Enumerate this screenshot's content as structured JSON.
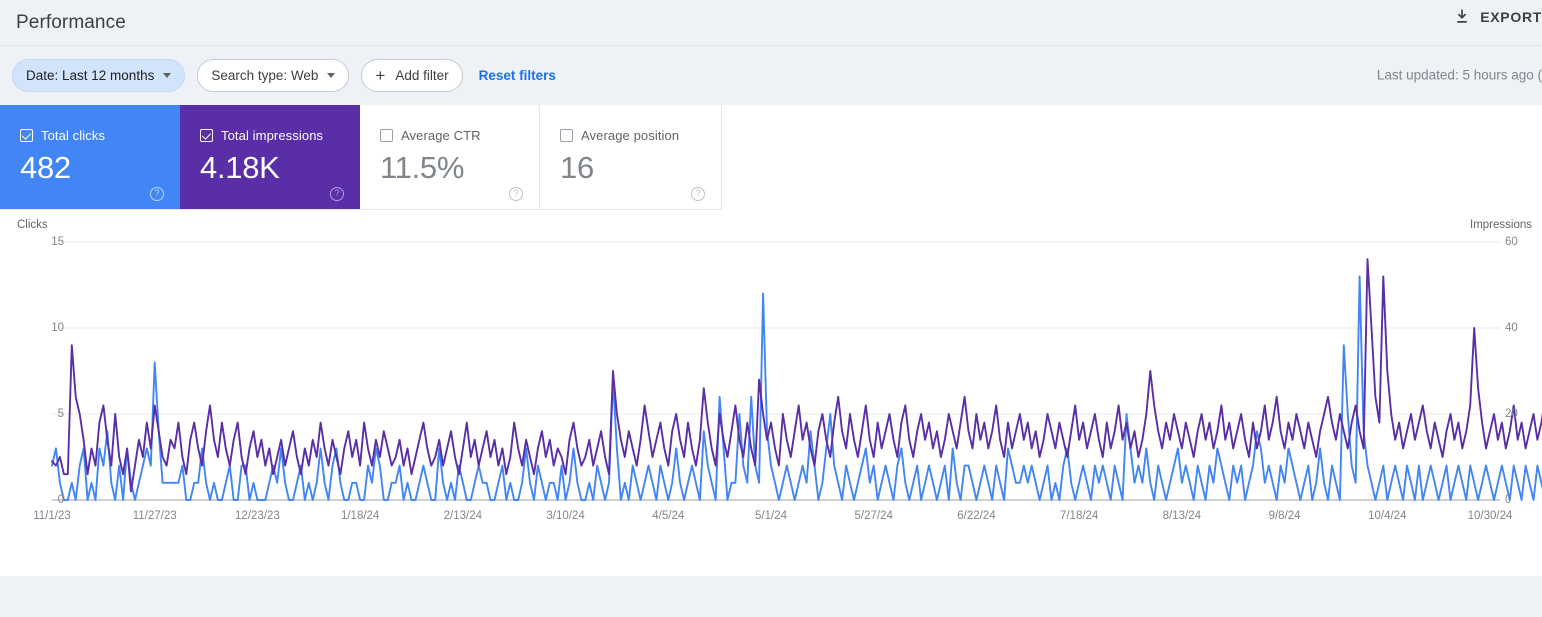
{
  "header": {
    "title": "Performance",
    "export_label": "EXPORT",
    "export_icon": "download-icon"
  },
  "filters": {
    "date_chip": "Date: Last 12 months",
    "search_type_chip": "Search type: Web",
    "add_filter": "Add filter",
    "reset_filters": "Reset filters",
    "last_updated": "Last updated: 5 hours ago ("
  },
  "metrics": [
    {
      "label": "Total clicks",
      "value": "482",
      "checked": true,
      "theme": "blue"
    },
    {
      "label": "Total impressions",
      "value": "4.18K",
      "checked": true,
      "theme": "purple"
    },
    {
      "label": "Average CTR",
      "value": "11.5%",
      "checked": false,
      "theme": "plain"
    },
    {
      "label": "Average position",
      "value": "16",
      "checked": false,
      "theme": "plain"
    }
  ],
  "colors": {
    "clicks": "#4285f4",
    "impressions": "#5a2ea6",
    "accent_link": "#1a73e8",
    "chip_active_bg": "#d2e3fc",
    "page_bg": "#eef1f6"
  },
  "chart_data": {
    "type": "line",
    "title": "",
    "xlabel": "",
    "grid": true,
    "legend": "metric-cards",
    "left_axis": {
      "label": "Clicks",
      "ticks": [
        0,
        5,
        10,
        15
      ],
      "ylim": [
        0,
        15
      ]
    },
    "right_axis": {
      "label": "Impressions",
      "ticks": [
        0,
        20,
        40,
        60
      ],
      "ylim": [
        0,
        60
      ]
    },
    "x_tick_labels": [
      "11/1/23",
      "11/27/23",
      "12/23/23",
      "1/18/24",
      "2/13/24",
      "3/10/24",
      "4/5/24",
      "5/1/24",
      "5/27/24",
      "6/22/24",
      "7/18/24",
      "8/13/24",
      "9/8/24",
      "10/4/24",
      "10/30/24"
    ],
    "x_tick_positions": [
      0,
      26,
      52,
      78,
      104,
      130,
      156,
      182,
      208,
      234,
      260,
      286,
      312,
      338,
      364
    ],
    "n_points": 365,
    "series": [
      {
        "name": "Total clicks",
        "color": "#4285f4",
        "axis": "left",
        "unit": "clicks",
        "values": [
          2,
          3,
          1,
          0,
          0,
          1,
          0,
          2,
          3,
          0,
          1,
          0,
          3,
          2,
          4,
          1,
          0,
          2,
          0,
          3,
          1,
          0,
          1,
          2,
          3,
          2,
          8,
          4,
          1,
          1,
          1,
          1,
          1,
          2,
          0,
          0,
          1,
          1,
          3,
          1,
          0,
          1,
          0,
          0,
          1,
          2,
          0,
          0,
          2,
          2,
          0,
          1,
          0,
          0,
          0,
          1,
          2,
          1,
          3,
          1,
          0,
          0,
          1,
          2,
          0,
          1,
          0,
          1,
          3,
          1,
          0,
          2,
          3,
          1,
          0,
          0,
          1,
          1,
          0,
          0,
          2,
          1,
          3,
          2,
          0,
          0,
          1,
          1,
          2,
          0,
          1,
          0,
          0,
          1,
          2,
          1,
          0,
          0,
          3,
          1,
          0,
          1,
          0,
          2,
          1,
          0,
          0,
          1,
          2,
          1,
          1,
          0,
          0,
          1,
          2,
          0,
          1,
          0,
          0,
          1,
          3,
          1,
          0,
          2,
          1,
          0,
          1,
          1,
          0,
          2,
          0,
          1,
          3,
          1,
          0,
          0,
          1,
          0,
          2,
          1,
          0,
          1,
          7,
          3,
          0,
          1,
          0,
          2,
          1,
          0,
          1,
          2,
          1,
          0,
          2,
          1,
          0,
          1,
          3,
          1,
          0,
          1,
          2,
          1,
          0,
          4,
          2,
          1,
          0,
          6,
          3,
          0,
          1,
          1,
          5,
          2,
          1,
          6,
          2,
          1,
          12,
          4,
          2,
          1,
          0,
          1,
          2,
          1,
          0,
          1,
          2,
          1,
          4,
          2,
          0,
          1,
          3,
          5,
          2,
          1,
          0,
          2,
          1,
          0,
          1,
          2,
          3,
          1,
          2,
          0,
          1,
          2,
          1,
          0,
          2,
          3,
          1,
          0,
          1,
          2,
          0,
          1,
          2,
          1,
          0,
          1,
          2,
          0,
          3,
          1,
          0,
          2,
          2,
          1,
          0,
          1,
          2,
          1,
          0,
          2,
          1,
          0,
          3,
          2,
          1,
          1,
          2,
          1,
          2,
          1,
          0,
          1,
          2,
          0,
          1,
          0,
          2,
          3,
          1,
          0,
          1,
          2,
          1,
          0,
          2,
          1,
          2,
          1,
          0,
          2,
          1,
          0,
          5,
          3,
          1,
          2,
          1,
          3,
          1,
          0,
          2,
          1,
          0,
          1,
          2,
          3,
          1,
          2,
          1,
          0,
          2,
          1,
          0,
          2,
          1,
          3,
          2,
          1,
          0,
          2,
          1,
          2,
          0,
          1,
          2,
          4,
          3,
          1,
          2,
          1,
          0,
          2,
          1,
          3,
          2,
          1,
          0,
          1,
          2,
          0,
          1,
          3,
          1,
          0,
          2,
          1,
          0,
          9,
          5,
          2,
          1,
          13,
          4,
          2,
          1,
          0,
          1,
          2,
          0,
          1,
          2,
          1,
          0,
          2,
          1,
          0,
          2,
          0,
          1,
          2,
          1,
          0,
          1,
          2,
          0,
          1,
          2,
          1,
          0,
          2,
          1,
          0,
          1,
          2,
          1,
          0,
          1,
          2,
          1,
          0,
          2,
          1,
          0,
          2,
          1,
          0,
          2,
          1,
          0,
          1,
          2,
          0,
          1,
          0
        ]
      },
      {
        "name": "Total impressions",
        "color": "#5a2ea6",
        "axis": "right",
        "unit": "impressions",
        "values": [
          9,
          8,
          10,
          6,
          6,
          36,
          24,
          20,
          14,
          6,
          12,
          8,
          18,
          22,
          14,
          8,
          20,
          10,
          6,
          12,
          2,
          8,
          14,
          10,
          18,
          12,
          22,
          16,
          10,
          8,
          14,
          12,
          18,
          10,
          6,
          14,
          18,
          12,
          8,
          16,
          22,
          14,
          10,
          18,
          12,
          8,
          14,
          18,
          10,
          6,
          12,
          16,
          10,
          14,
          8,
          12,
          6,
          10,
          14,
          8,
          12,
          16,
          10,
          6,
          12,
          8,
          14,
          10,
          18,
          12,
          8,
          14,
          10,
          6,
          12,
          16,
          10,
          14,
          8,
          18,
          12,
          8,
          14,
          10,
          16,
          12,
          8,
          10,
          14,
          8,
          12,
          6,
          10,
          14,
          18,
          12,
          8,
          10,
          14,
          8,
          12,
          16,
          10,
          6,
          12,
          18,
          10,
          14,
          8,
          12,
          16,
          10,
          14,
          8,
          12,
          6,
          10,
          18,
          12,
          8,
          14,
          10,
          6,
          12,
          16,
          10,
          14,
          8,
          12,
          10,
          6,
          14,
          18,
          12,
          8,
          10,
          14,
          8,
          12,
          16,
          10,
          6,
          30,
          20,
          14,
          10,
          16,
          12,
          8,
          14,
          22,
          16,
          10,
          14,
          18,
          12,
          8,
          16,
          20,
          14,
          10,
          18,
          12,
          8,
          14,
          26,
          18,
          12,
          8,
          20,
          14,
          10,
          16,
          22,
          14,
          10,
          18,
          12,
          8,
          28,
          20,
          14,
          18,
          12,
          8,
          20,
          14,
          10,
          16,
          22,
          14,
          18,
          12,
          8,
          16,
          20,
          14,
          10,
          18,
          24,
          16,
          12,
          20,
          14,
          10,
          16,
          22,
          14,
          10,
          18,
          12,
          16,
          20,
          14,
          10,
          18,
          22,
          14,
          10,
          16,
          20,
          14,
          18,
          12,
          16,
          10,
          14,
          20,
          16,
          12,
          18,
          24,
          16,
          12,
          20,
          14,
          18,
          12,
          16,
          22,
          14,
          10,
          18,
          12,
          16,
          20,
          14,
          18,
          12,
          16,
          10,
          14,
          20,
          16,
          12,
          18,
          14,
          10,
          16,
          22,
          14,
          18,
          12,
          16,
          20,
          14,
          10,
          18,
          12,
          16,
          22,
          14,
          18,
          12,
          16,
          10,
          14,
          20,
          30,
          22,
          16,
          12,
          18,
          14,
          20,
          16,
          12,
          18,
          14,
          10,
          16,
          20,
          14,
          18,
          12,
          16,
          22,
          14,
          18,
          12,
          16,
          20,
          14,
          10,
          18,
          12,
          16,
          22,
          14,
          18,
          24,
          16,
          12,
          18,
          14,
          20,
          16,
          12,
          18,
          14,
          10,
          16,
          20,
          24,
          18,
          14,
          20,
          16,
          12,
          18,
          22,
          16,
          12,
          56,
          40,
          24,
          18,
          52,
          30,
          20,
          14,
          18,
          12,
          16,
          20,
          14,
          18,
          22,
          16,
          12,
          18,
          14,
          10,
          16,
          20,
          14,
          18,
          12,
          16,
          22,
          40,
          26,
          18,
          12,
          16,
          20,
          14,
          18,
          12,
          16,
          22,
          14,
          18,
          12,
          16,
          20,
          14,
          18,
          24,
          16,
          12,
          18,
          14,
          20,
          16,
          12,
          18,
          22,
          16,
          12,
          18,
          14,
          20,
          16,
          12,
          18,
          22,
          16,
          20,
          14,
          18,
          22
        ]
      }
    ]
  }
}
